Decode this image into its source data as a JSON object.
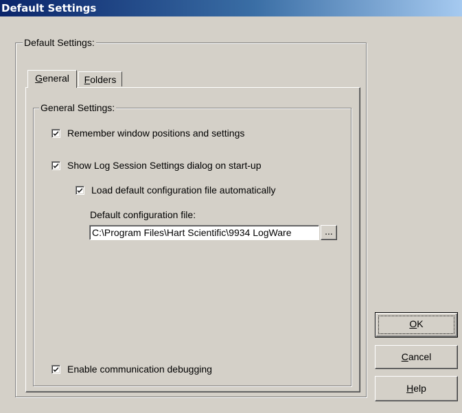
{
  "window": {
    "title": "Default Settings"
  },
  "outer_group": {
    "label": "Default Settings:"
  },
  "tabs": [
    {
      "prefix": "",
      "accel": "G",
      "rest": "eneral",
      "active": true
    },
    {
      "prefix": "",
      "accel": "F",
      "rest": "olders",
      "active": false
    }
  ],
  "general_group": {
    "label": "General Settings:"
  },
  "options": {
    "remember_positions": {
      "label": "Remember window positions and settings",
      "checked": true
    },
    "show_log_session": {
      "label": "Show Log Session Settings dialog on start-up",
      "checked": true
    },
    "load_default_config": {
      "label": "Load default configuration file automatically",
      "checked": true
    },
    "comm_debugging": {
      "label": "Enable communication debugging",
      "checked": true
    }
  },
  "config_file": {
    "label": "Default configuration file:",
    "value": "C:\\Program Files\\Hart Scientific\\9934 LogWare",
    "browse_label": "..."
  },
  "buttons": {
    "ok": {
      "accel": "O",
      "rest": "K"
    },
    "cancel": {
      "accel": "C",
      "rest": "ancel"
    },
    "help": {
      "accel": "H",
      "rest": "elp"
    }
  }
}
